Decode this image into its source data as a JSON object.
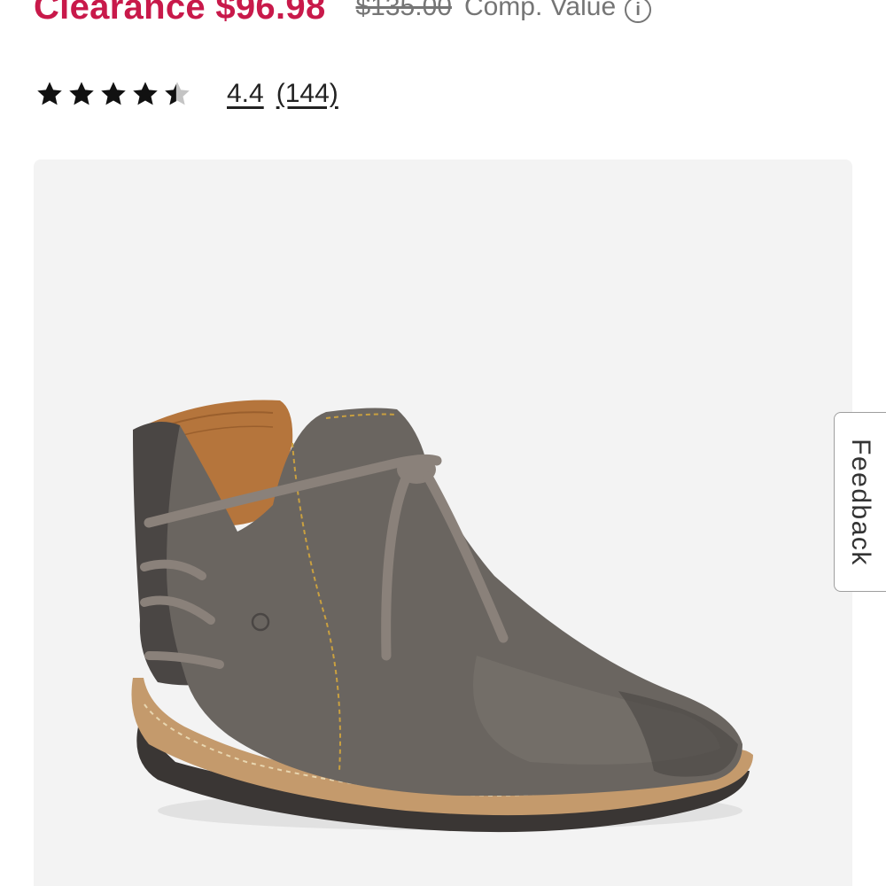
{
  "price": {
    "sale": "Clearance $96.98",
    "original": "$135.00",
    "comp_label": "Comp. Value",
    "info_symbol": "i"
  },
  "rating": {
    "value": "4.4",
    "count": "(144)",
    "stars_out_of_5": 4.4
  },
  "feedback": {
    "label": "Feedback"
  },
  "colors": {
    "sale_red": "#c8194a",
    "muted_gray": "#757575",
    "image_background": "#f3f3f3"
  },
  "icons": {
    "info": "info-circle-icon",
    "star": "star-icon"
  }
}
